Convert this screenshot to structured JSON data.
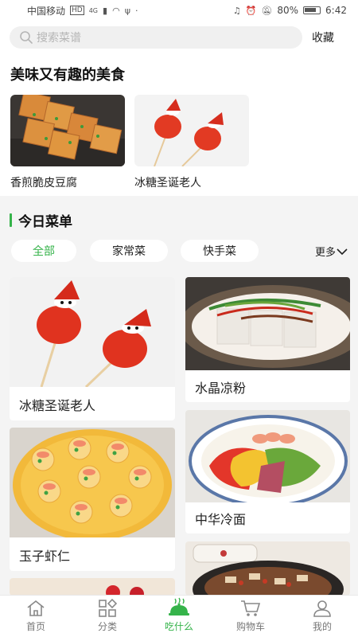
{
  "status": {
    "carrier": "中国移动",
    "hd": "HD",
    "signal": "4G",
    "battery": "80%",
    "time": "6:42"
  },
  "search": {
    "placeholder": "搜索菜谱",
    "favorites_label": "收藏"
  },
  "featured": {
    "title": "美味又有趣的美食",
    "items": [
      {
        "label": "香煎脆皮豆腐",
        "icon": "fried-tofu-photo"
      },
      {
        "label": "冰糖圣诞老人",
        "icon": "candied-santa-photo"
      }
    ]
  },
  "today_menu": {
    "title": "今日菜单",
    "chips": [
      "全部",
      "家常菜",
      "快手菜"
    ],
    "active_chip": "全部",
    "more_label": "更多"
  },
  "cards": [
    {
      "label": "冰糖圣诞老人",
      "icon": "candied-santa-photo"
    },
    {
      "label": "水晶凉粉",
      "icon": "crystal-jelly-photo"
    },
    {
      "label": "玉子虾仁",
      "icon": "tamago-shrimp-photo"
    },
    {
      "label": "中华冷面",
      "icon": "cold-noodle-photo"
    },
    {
      "label": "",
      "icon": "partial-dish-photo"
    },
    {
      "label": "",
      "icon": "partial-dish-photo"
    }
  ],
  "tabs": [
    {
      "label": "首页",
      "icon": "home-icon"
    },
    {
      "label": "分类",
      "icon": "category-icon"
    },
    {
      "label": "吃什么",
      "icon": "dish-icon",
      "active": true
    },
    {
      "label": "购物车",
      "icon": "cart-icon"
    },
    {
      "label": "我的",
      "icon": "user-icon"
    }
  ],
  "colors": {
    "accent": "#35b34a",
    "background": "#f4f4f4"
  }
}
